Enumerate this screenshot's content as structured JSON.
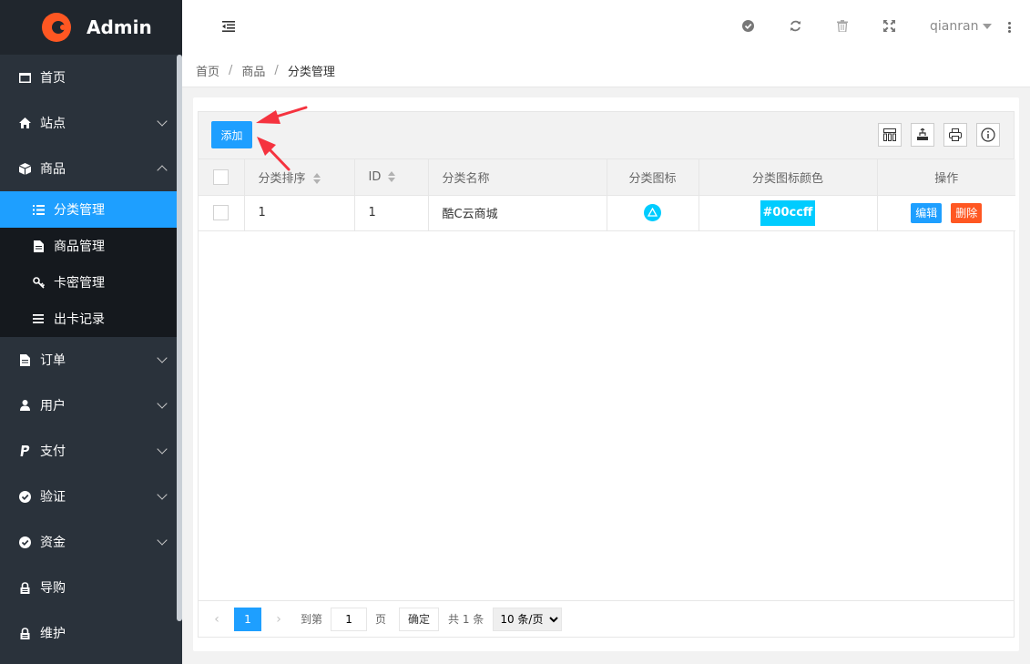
{
  "brand": {
    "title": "Admin"
  },
  "sidebar": {
    "items": [
      {
        "label": "首页",
        "icon": "window-icon"
      },
      {
        "label": "站点",
        "icon": "home-icon"
      },
      {
        "label": "商品",
        "icon": "cube-icon"
      },
      {
        "label": "订单",
        "icon": "file-icon"
      },
      {
        "label": "用户",
        "icon": "user-icon"
      },
      {
        "label": "支付",
        "icon": "paypal-icon"
      },
      {
        "label": "验证",
        "icon": "check-circle-icon"
      },
      {
        "label": "资金",
        "icon": "check-circle-icon"
      },
      {
        "label": "导购",
        "icon": "lock-icon"
      },
      {
        "label": "维护",
        "icon": "lock-icon"
      }
    ],
    "submenu": [
      {
        "label": "分类管理",
        "icon": "list-icon"
      },
      {
        "label": "商品管理",
        "icon": "file-icon"
      },
      {
        "label": "卡密管理",
        "icon": "key-icon"
      },
      {
        "label": "出卡记录",
        "icon": "menu-icon"
      }
    ]
  },
  "header": {
    "username": "qianran"
  },
  "breadcrumb": {
    "home": "首页",
    "parent": "商品",
    "current": "分类管理"
  },
  "toolbar": {
    "add_label": "添加"
  },
  "table": {
    "columns": [
      "分类排序",
      "ID",
      "分类名称",
      "分类图标",
      "分类图标颜色",
      "操作"
    ],
    "rows": [
      {
        "sort": "1",
        "id": "1",
        "name": "酷C云商城",
        "color": "#00ccff",
        "edit": "编辑",
        "delete": "删除"
      }
    ]
  },
  "pager": {
    "current": "1",
    "goto_label": "到第",
    "page_input": "1",
    "page_unit": "页",
    "confirm": "确定",
    "total": "共 1 条",
    "per_page": "10 条/页"
  },
  "colors": {
    "accent": "#1e9fff",
    "danger": "#ff5722",
    "sidebar": "#2a323b",
    "annotation_arrow": "#f5333f"
  }
}
